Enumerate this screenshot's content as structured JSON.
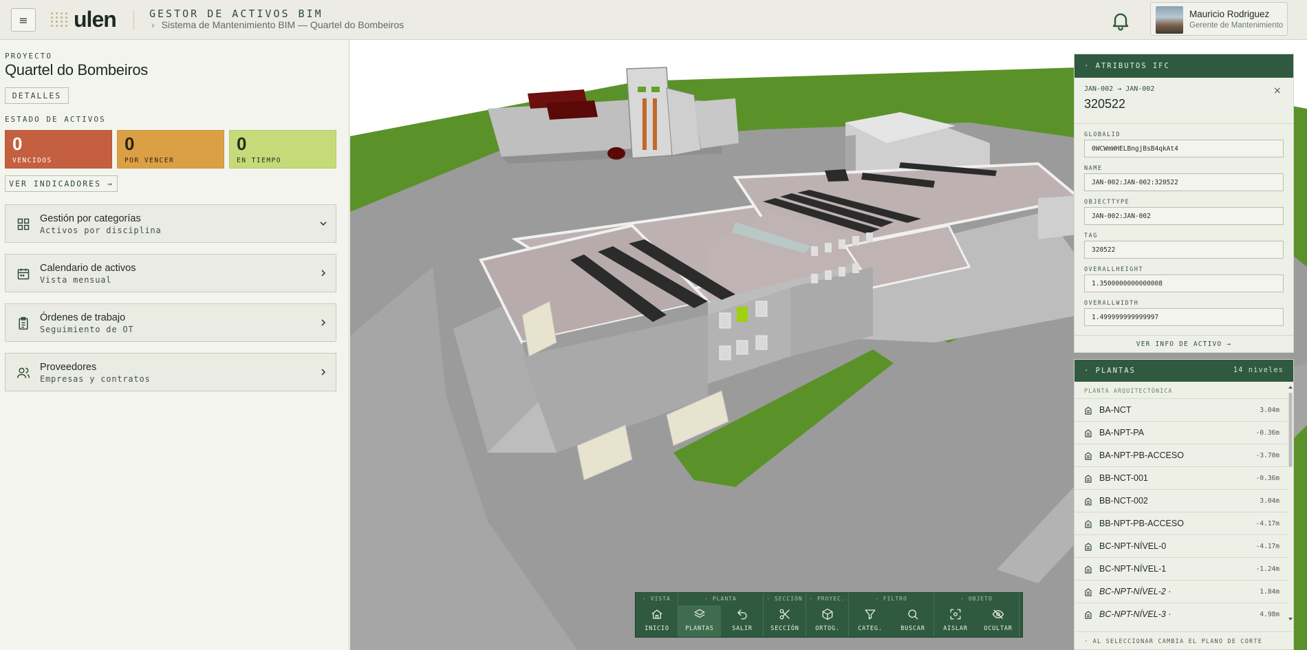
{
  "header": {
    "menu_icon": "≡",
    "logo_text": "ulen",
    "app_title": "GESTOR DE ACTIVOS BIM",
    "breadcrumb": "Sistema de Mantenimiento BIM — Quartel do Bombeiros",
    "user_name": "Mauricio Rodriguez",
    "user_role": "Gerente de Mantenimiento"
  },
  "project": {
    "label": "PROYECTO",
    "name": "Quartel do Bombeiros",
    "details_label": "DETALLES",
    "status_label": "ESTADO DE ACTIVOS",
    "stats": [
      {
        "value": "0",
        "label": "VENCIDOS",
        "color": "#c4603f"
      },
      {
        "value": "0",
        "label": "POR VENCER",
        "color": "#dca044"
      },
      {
        "value": "0",
        "label": "EN TIEMPO",
        "color": "#c6da7a"
      }
    ],
    "indicators_label": "VER INDICADORES →"
  },
  "cards": [
    {
      "title": "Gestión por categorías",
      "subtitle": "Activos por disciplina",
      "icon": "grid-icon",
      "chevron": "chevron-down-icon"
    },
    {
      "title": "Calendario de activos",
      "subtitle": "Vista mensual",
      "icon": "calendar-icon",
      "chevron": "chevron-right-icon"
    },
    {
      "title": "Órdenes de trabajo",
      "subtitle": "Seguimiento de OT",
      "icon": "clipboard-icon",
      "chevron": "chevron-right-icon"
    },
    {
      "title": "Proveedores",
      "subtitle": "Empresas y contratos",
      "icon": "users-icon",
      "chevron": "chevron-right-icon"
    }
  ],
  "ifc": {
    "header": "· ATRIBUTOS IFC",
    "subtitle": "JAN-002 → JAN-002",
    "id": "320522",
    "close": "×",
    "fields": [
      {
        "label": "GLOBALID",
        "value": "0WCWmWHELBngjBsB4qkAt4"
      },
      {
        "label": "NAME",
        "value": "JAN-002:JAN-002:320522"
      },
      {
        "label": "OBJECTTYPE",
        "value": "JAN-002:JAN-002"
      },
      {
        "label": "TAG",
        "value": "320522"
      },
      {
        "label": "OVERALLHEIGHT",
        "value": "1.3500000000000008"
      },
      {
        "label": "OVERALLWIDTH",
        "value": "1.499999999999997"
      }
    ],
    "footer": "VER INFO DE ACTIVO →"
  },
  "plantas": {
    "header": "· PLANTAS",
    "count": "14 niveles",
    "section": "PLANTA ARQUITECTÓNICA",
    "levels": [
      {
        "name": "BA-NCT",
        "elev": "3.04m",
        "italic": false
      },
      {
        "name": "BA-NPT-PA",
        "elev": "-0.36m",
        "italic": false
      },
      {
        "name": "BA-NPT-PB-ACCESO",
        "elev": "-3.70m",
        "italic": false
      },
      {
        "name": "BB-NCT-001",
        "elev": "-0.36m",
        "italic": false
      },
      {
        "name": "BB-NCT-002",
        "elev": "3.04m",
        "italic": false
      },
      {
        "name": "BB-NPT-PB-ACCESO",
        "elev": "-4.17m",
        "italic": false
      },
      {
        "name": "BC-NPT-NÍVEL-0",
        "elev": "-4.17m",
        "italic": false
      },
      {
        "name": "BC-NPT-NÍVEL-1",
        "elev": "-1.24m",
        "italic": false
      },
      {
        "name": "BC-NPT-NÍVEL-2 ·",
        "elev": "1.84m",
        "italic": true
      },
      {
        "name": "BC-NPT-NÍVEL-3 ·",
        "elev": "4.98m",
        "italic": true
      }
    ],
    "footer": "· AL SELECCIONAR CAMBIA EL PLANO DE CORTE"
  },
  "toolbar": {
    "groups": [
      {
        "label": "· VISTA",
        "buttons": [
          {
            "label": "INICIO",
            "icon": "home-icon",
            "active": false
          }
        ]
      },
      {
        "label": "· PLANTA",
        "buttons": [
          {
            "label": "PLANTAS",
            "icon": "layers-icon",
            "active": true
          },
          {
            "label": "SALIR",
            "icon": "undo-icon",
            "active": false
          }
        ]
      },
      {
        "label": "· SECCIÓN",
        "buttons": [
          {
            "label": "SECCIÓN",
            "icon": "scissors-icon",
            "active": false
          }
        ]
      },
      {
        "label": "· PROYEC.",
        "buttons": [
          {
            "label": "ORTOG.",
            "icon": "cube-icon",
            "active": false
          }
        ]
      },
      {
        "label": "· FILTRO",
        "buttons": [
          {
            "label": "CATEG.",
            "icon": "filter-icon",
            "active": false
          },
          {
            "label": "BUSCAR",
            "icon": "search-icon",
            "active": false
          }
        ]
      },
      {
        "label": "· OBJETO",
        "buttons": [
          {
            "label": "AISLAR",
            "icon": "focus-icon",
            "active": false
          },
          {
            "label": "OCULTAR",
            "icon": "eye-off-icon",
            "active": false
          }
        ]
      }
    ]
  },
  "colors": {
    "brand_green": "#2f5a40",
    "grass": "#5a9229",
    "highlight": "#9fd012"
  }
}
